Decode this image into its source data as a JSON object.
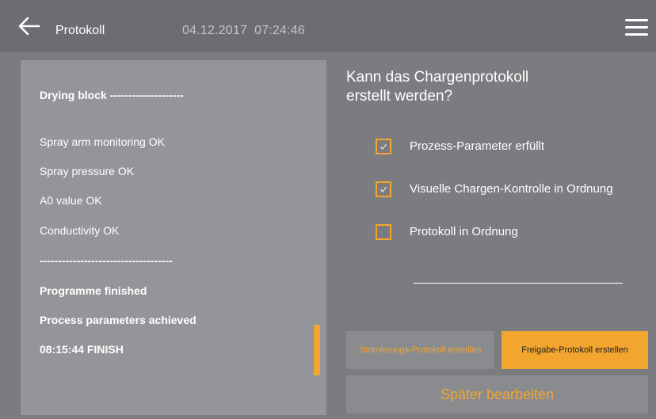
{
  "header": {
    "back_icon": "arrow-left-icon",
    "title": "Protokoll",
    "date": "04.12.2017",
    "time": "07:24:46",
    "menu_icon": "hamburger-menu-icon"
  },
  "log": {
    "lines": [
      {
        "text": "Drying block --------------------",
        "bold": true
      },
      {
        "text": "Spray arm monitoring OK",
        "bold": false
      },
      {
        "text": "Spray pressure OK",
        "bold": false
      },
      {
        "text": "A0 value OK",
        "bold": false
      },
      {
        "text": "Conductivity OK",
        "bold": false
      },
      {
        "text": "------------------------------------",
        "bold": true
      },
      {
        "text": "Programme finished",
        "bold": true
      },
      {
        "text": "Process parameters achieved",
        "bold": true
      },
      {
        "text": "08:15:44 FINISH",
        "bold": true
      }
    ]
  },
  "dialog": {
    "question_line1": "Kann das Chargenprotokoll",
    "question_line2": "erstellt werden?",
    "checks": [
      {
        "label": "Prozess-Parameter erfüllt",
        "checked": true
      },
      {
        "label": "Visuelle Chargen-Kontrolle in Ordnung",
        "checked": true
      },
      {
        "label": "Protokoll in Ordnung",
        "checked": false
      }
    ],
    "buttons": {
      "cancel_protocol": "Stornierungs-Protokoll erstellen",
      "release_protocol": "Freigabe-Protokoll erstellen",
      "later": "Später bearbeiten"
    }
  },
  "colors": {
    "accent": "#f2a52f",
    "topbar": "#6c6d71",
    "background": "#7b7c80",
    "panel": "#949599"
  }
}
